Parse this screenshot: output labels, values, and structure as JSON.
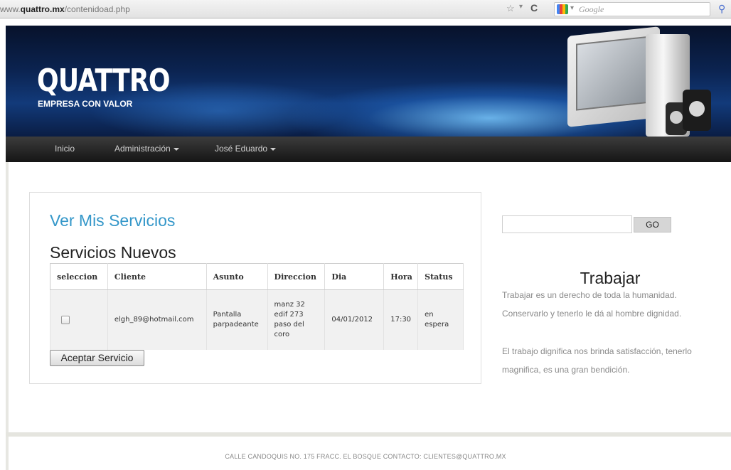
{
  "browser": {
    "url_prefix": "www.",
    "url_domain": "quattro.mx",
    "url_path": "/contenidoad.php",
    "search_placeholder": "Google"
  },
  "header": {
    "logo_text": "QUATTRO",
    "tagline": "EMPRESA CON VALOR"
  },
  "nav": {
    "items": [
      {
        "label": "Inicio",
        "has_dropdown": false
      },
      {
        "label": "Administración",
        "has_dropdown": true
      },
      {
        "label": "José Eduardo",
        "has_dropdown": true
      }
    ]
  },
  "main": {
    "card_title": "Ver Mis Servicios",
    "section_title": "Servicios Nuevos",
    "table": {
      "headers": [
        "seleccion",
        "Cliente",
        "Asunto",
        "Direccion",
        "Dia",
        "Hora",
        "Status"
      ],
      "rows": [
        {
          "checked": false,
          "cliente": "elgh_89@hotmail.com",
          "asunto": "Pantalla parpadeante",
          "direccion": "manz 32 edif 273 paso del coro",
          "dia": "04/01/2012",
          "hora": "17:30",
          "status": "en espera"
        }
      ]
    },
    "accept_button": "Aceptar Servicio"
  },
  "sidebar": {
    "search_value": "",
    "go_button": "GO",
    "title": "Trabajar",
    "paragraph1": "Trabajar es un derecho de toda la humanidad. Conservarlo y tenerlo le dá al hombre dignidad.",
    "paragraph2": "El trabajo dignifica nos brinda satisfacción, tenerlo magnifica, es una gran bendición."
  },
  "footer": {
    "text": "CALLE CANDOQUIS NO. 175 FRACC. EL BOSQUE CONTACTO: CLIENTES@QUATTRO.MX"
  }
}
